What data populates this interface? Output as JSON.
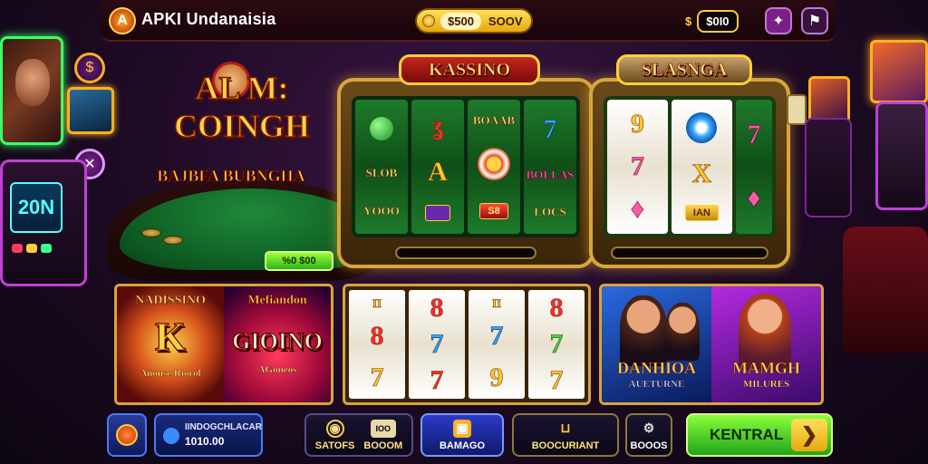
{
  "app": {
    "logo_glyph": "A",
    "title": "APKI Undanaisia"
  },
  "topbar": {
    "balance_value": "$500",
    "balance_button": "SOOV",
    "coin_label": "$",
    "coin_value": "$0I0",
    "star_icon": "star-icon",
    "flag_icon": "flag-icon"
  },
  "hero": {
    "line1": "AL M:",
    "line2": "COINGH",
    "subtitle": "BAJBFA BUBNGHA"
  },
  "left": {
    "machine_screen": "20N"
  },
  "table": {
    "bet_button": "%0 $00"
  },
  "machines": [
    {
      "sign": "KASSINO",
      "reels": [
        [
          "SLOB",
          "",
          "YOOO"
        ],
        [
          "",
          "A",
          ""
        ],
        [
          "BOAAB",
          "",
          "S8"
        ],
        [
          "7",
          "BOLLAS",
          "LOCS"
        ]
      ]
    },
    {
      "sign": "SLASNGA",
      "reels": [
        [
          "9",
          "7",
          ""
        ],
        [
          "",
          "X",
          "IAN"
        ],
        [
          "7",
          "",
          ""
        ]
      ]
    }
  ],
  "cards": [
    {
      "title": "NADISSINO",
      "big": "K",
      "sub": "Aiiouse Riorol"
    },
    {
      "title": "Mefiandon",
      "big": "GIOINO",
      "sub": "AGoneos"
    },
    {
      "reels": [
        [
          "II",
          "8",
          "7"
        ],
        [
          "8",
          "7",
          "7"
        ],
        [
          "II",
          "7",
          "9"
        ],
        [
          "8",
          "7",
          "7"
        ]
      ]
    },
    {
      "title": "DANHIOA",
      "sub": "AUETURNE"
    },
    {
      "title": "MAMGH",
      "sub": "MILURES"
    }
  ],
  "bottom": {
    "info_label": "IINDOGCHLACAR",
    "info_value": "1010.00",
    "nav1_a": "SATOFS",
    "nav1_b_top": "IOO",
    "nav1_b": "BOOOM",
    "nav2": "BAMAGO",
    "nav3": "BOOCURIANT",
    "nav4": "BOOOS",
    "cta": "KENTRAL"
  },
  "colors": {
    "accent_gold": "#ffcf3a",
    "cta_green": "#22a41a",
    "brand_red": "#c4261e"
  }
}
